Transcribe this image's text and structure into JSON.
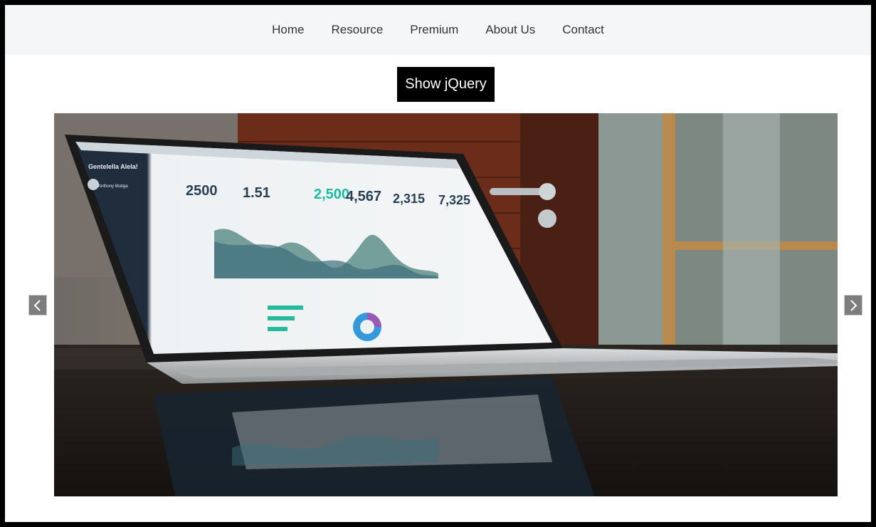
{
  "nav": {
    "items": [
      {
        "label": "Home"
      },
      {
        "label": "Resource"
      },
      {
        "label": "Premium"
      },
      {
        "label": "About Us"
      },
      {
        "label": "Contact"
      }
    ]
  },
  "show_button": {
    "label": "Show jQuery"
  },
  "carousel": {
    "slide_icon": "laptop-analytics-photo",
    "prev_icon": "chevron-left-icon",
    "next_icon": "chevron-right-icon",
    "dashboard": {
      "brand": "Gentelella Alela!",
      "user": "Anthony Mutiga",
      "stats": [
        "2500",
        "1.51",
        "2,500",
        "4,567",
        "2,315",
        "7,325"
      ]
    }
  },
  "colors": {
    "nav_background": "#f5f6f7",
    "nav_text": "#333333",
    "button_background": "#000000",
    "button_text": "#ffffff",
    "frame_border": "#000000",
    "arrow_background": "#7d7d7d"
  }
}
